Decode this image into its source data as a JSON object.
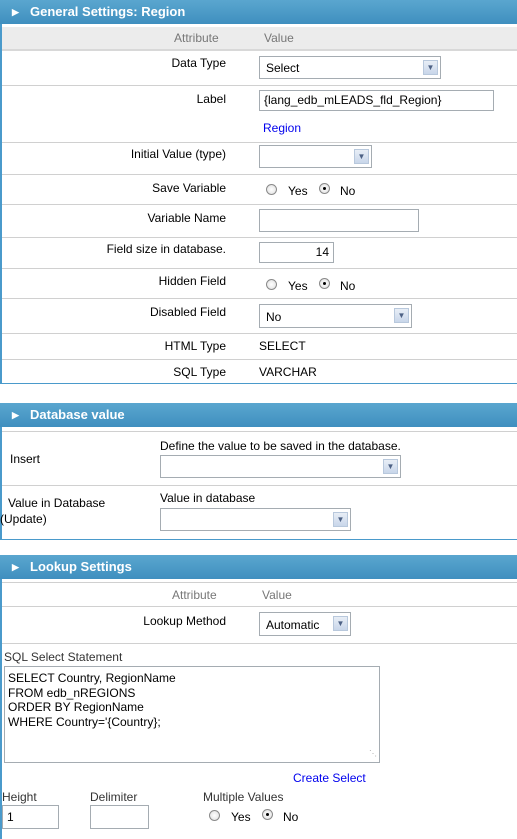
{
  "general": {
    "title": "General Settings: Region",
    "col_attribute": "Attribute",
    "col_value": "Value",
    "data_type": {
      "label": "Data Type",
      "value": "Select"
    },
    "label": {
      "label": "Label",
      "value": "{lang_edb_mLEADS_fld_Region}",
      "link": "Region"
    },
    "initial_value": {
      "label": "Initial Value (type)",
      "value": ""
    },
    "save_variable": {
      "label": "Save Variable",
      "yes": "Yes",
      "no": "No",
      "selected": "No"
    },
    "variable_name": {
      "label": "Variable Name",
      "value": ""
    },
    "field_size": {
      "label": "Field size in database.",
      "value": "14"
    },
    "hidden_field": {
      "label": "Hidden Field",
      "yes": "Yes",
      "no": "No",
      "selected": "No"
    },
    "disabled_field": {
      "label": "Disabled Field",
      "value": "No"
    },
    "html_type": {
      "label": "HTML Type",
      "value": "SELECT"
    },
    "sql_type": {
      "label": "SQL Type",
      "value": "VARCHAR"
    }
  },
  "database": {
    "title": "Database value",
    "insert": {
      "label": "Insert",
      "hint": "Define the value to be saved in the database.",
      "value": ""
    },
    "update": {
      "label1": "Value in Database",
      "label2": "(Update)",
      "hint": "Value in database",
      "value": ""
    }
  },
  "lookup": {
    "title": "Lookup Settings",
    "col_attribute": "Attribute",
    "col_value": "Value",
    "method": {
      "label": "Lookup Method",
      "value": "Automatic"
    },
    "sql_label": "SQL Select Statement",
    "sql_lines": [
      "SELECT Country, RegionName",
      "FROM edb_nREGIONS",
      "ORDER BY RegionName",
      "WHERE Country='{Country};"
    ],
    "create_select": "Create Select",
    "height": {
      "label": "Height",
      "value": "1"
    },
    "delimiter": {
      "label": "Delimiter",
      "value": ""
    },
    "multiple": {
      "label": "Multiple Values",
      "yes": "Yes",
      "no": "No",
      "selected": "No"
    }
  }
}
